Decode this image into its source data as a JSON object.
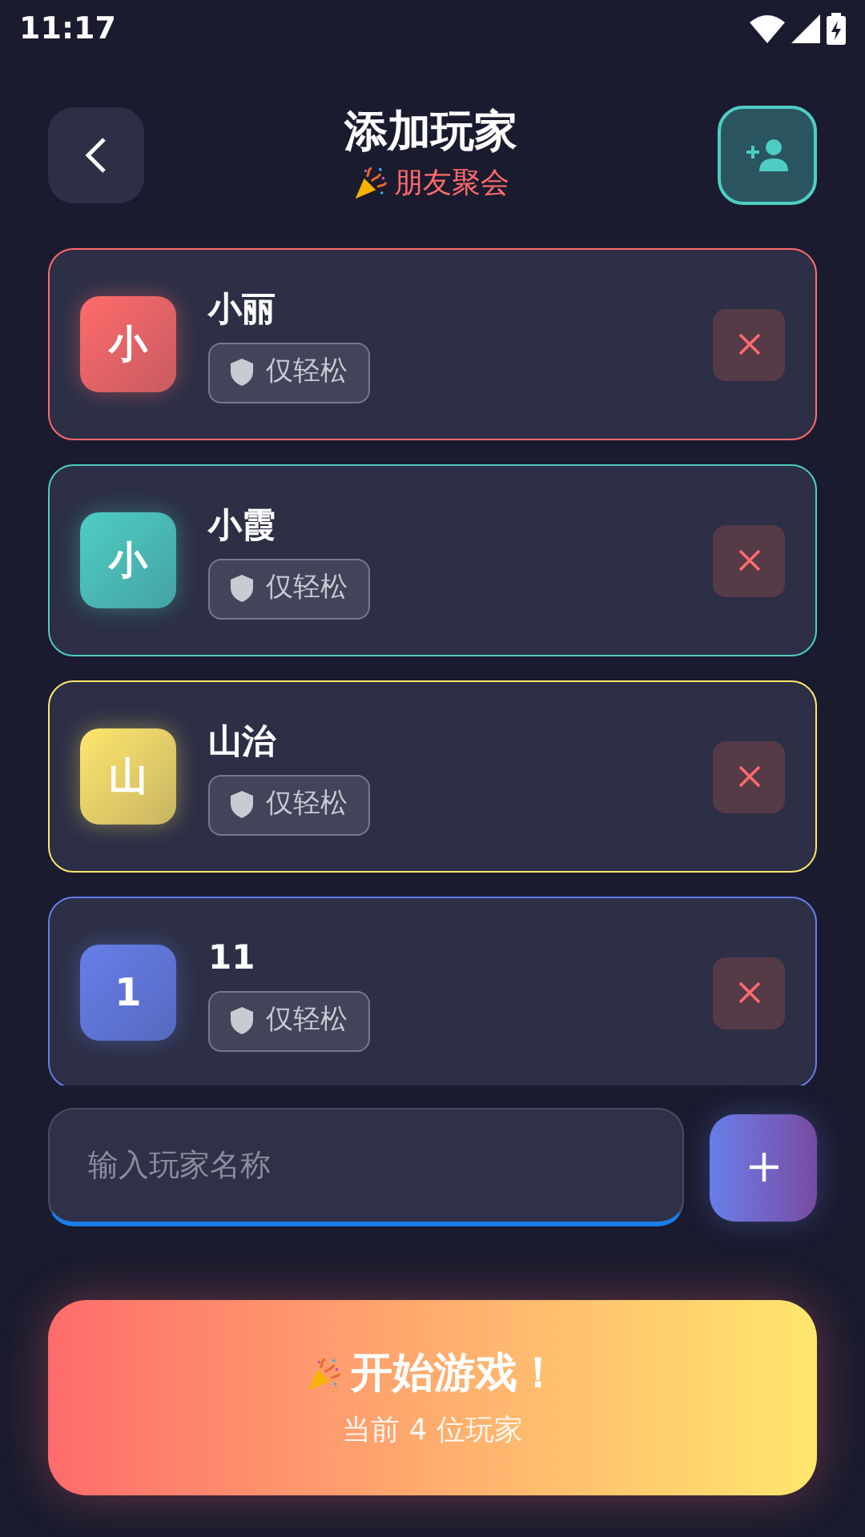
{
  "status_bar": {
    "time": "11:17"
  },
  "header": {
    "title": "添加玩家",
    "subtitle": "朋友聚会"
  },
  "players": [
    {
      "initial": "小",
      "name": "小丽",
      "tag": "仅轻松",
      "color": "#ff6b6b"
    },
    {
      "initial": "小",
      "name": "小霞",
      "tag": "仅轻松",
      "color": "#4ecdc4"
    },
    {
      "initial": "山",
      "name": "山治",
      "tag": "仅轻松",
      "color": "#ffe66d"
    },
    {
      "initial": "1",
      "name": "11",
      "tag": "仅轻松",
      "color": "#667eea"
    }
  ],
  "name_input": {
    "placeholder": "输入玩家名称"
  },
  "start_button": {
    "label": "开始游戏！",
    "caption": "当前 4 位玩家"
  }
}
